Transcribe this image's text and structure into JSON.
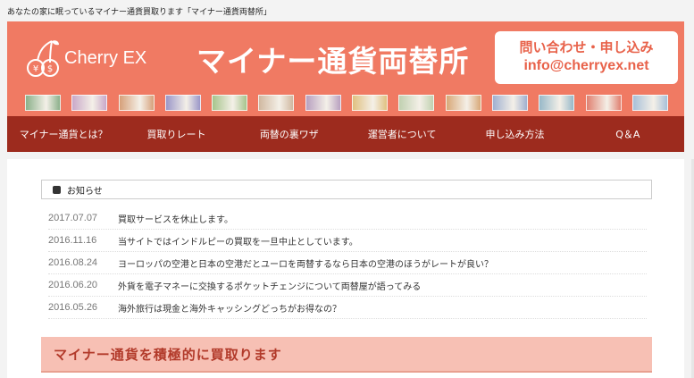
{
  "tagline": "あなたの家に眠っているマイナー通貨買取ります「マイナー通貨両替所」",
  "logo": {
    "text": "Cherry EX"
  },
  "header": {
    "title": "マイナー通貨両替所"
  },
  "contact": {
    "line1": "問い合わせ・申し込み",
    "line2": "info@cherryex.net"
  },
  "banknotes": [
    {
      "name": "banknote-1",
      "color": "#8bb08a"
    },
    {
      "name": "banknote-2",
      "color": "#c9a8c8"
    },
    {
      "name": "banknote-3",
      "color": "#d6a07a"
    },
    {
      "name": "banknote-4",
      "color": "#9a96c8"
    },
    {
      "name": "banknote-5",
      "color": "#a6c48c"
    },
    {
      "name": "banknote-6",
      "color": "#d0b8a0"
    },
    {
      "name": "banknote-7",
      "color": "#b8a0c0"
    },
    {
      "name": "banknote-8",
      "color": "#e0c080"
    },
    {
      "name": "banknote-9",
      "color": "#c0d0b0"
    },
    {
      "name": "banknote-10",
      "color": "#d8a878"
    },
    {
      "name": "banknote-11",
      "color": "#a0b0d0"
    },
    {
      "name": "banknote-12",
      "color": "#98b8c8"
    },
    {
      "name": "banknote-13",
      "color": "#e08070"
    },
    {
      "name": "banknote-14",
      "color": "#a8c0d8"
    }
  ],
  "nav": [
    {
      "id": "about",
      "label": "マイナー通貨とは？"
    },
    {
      "id": "rates",
      "label": "買取りレート"
    },
    {
      "id": "tricks",
      "label": "両替の裏ワザ"
    },
    {
      "id": "operator",
      "label": "運営者について"
    },
    {
      "id": "apply",
      "label": "申し込み方法"
    },
    {
      "id": "faq",
      "label": "Q＆A"
    }
  ],
  "news": {
    "heading": "お知らせ",
    "items": [
      {
        "date": "2017.07.07",
        "title": "買取サービスを休止します。"
      },
      {
        "date": "2016.11.16",
        "title": "当サイトではインドルピーの買取を一旦中止としています。"
      },
      {
        "date": "2016.08.24",
        "title": "ヨーロッパの空港と日本の空港だとユーロを両替するなら日本の空港のほうがレートが良い？"
      },
      {
        "date": "2016.06.20",
        "title": "外貨を電子マネーに交換するポケットチェンジについて両替屋が語ってみる"
      },
      {
        "date": "2016.05.26",
        "title": "海外旅行は現金と海外キャッシングどっちがお得なの？"
      }
    ]
  },
  "promo": {
    "text": "マイナー通貨を積極的に買取ります"
  },
  "colors": {
    "header_bg": "#f07a63",
    "nav_bg": "#9d2b1e",
    "accent": "#e8624a",
    "promo_bg": "#f7c0b4"
  }
}
